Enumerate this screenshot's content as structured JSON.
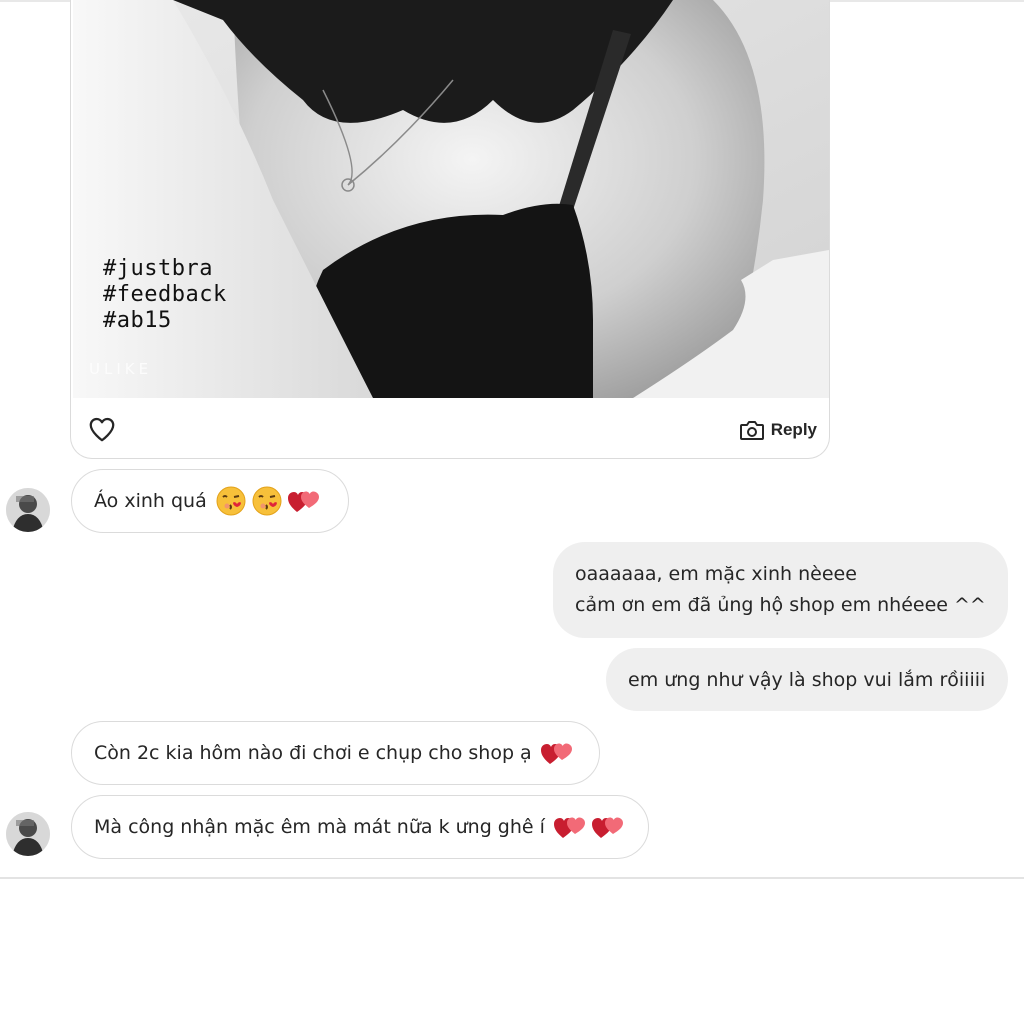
{
  "photo": {
    "hashtags": [
      "#justbra",
      "#feedback",
      "#ab15"
    ],
    "watermark": "ULIKE"
  },
  "card_actions": {
    "reply_label": "Reply",
    "like_icon": "heart-outline-icon",
    "camera_icon": "camera-icon"
  },
  "messages": [
    {
      "side": "incoming",
      "text": "Áo xinh quá",
      "emoji": [
        "kissing-face-icon",
        "kissing-face-icon",
        "two-hearts-icon"
      ]
    },
    {
      "side": "outgoing",
      "lines": [
        "oaaaaaa, em mặc xinh nèeee",
        "cảm ơn em đã ủng hộ shop em nhéeee ^^"
      ]
    },
    {
      "side": "outgoing",
      "text": "em ưng như vậy là shop vui lắm rồiiiii"
    },
    {
      "side": "incoming",
      "text": "Còn 2c kia hôm nào đi chơi e chụp cho shop ạ",
      "emoji": [
        "two-hearts-icon"
      ]
    },
    {
      "side": "incoming",
      "text": "Mà công nhận mặc êm mà mát nữa k ưng ghê í",
      "emoji": [
        "two-hearts-icon",
        "two-hearts-icon"
      ]
    }
  ],
  "colors": {
    "incoming_bubble": "#ffffff",
    "outgoing_bubble": "#efefef",
    "border": "#dbdbdb",
    "text": "#262626",
    "heart_red": "#e0243a"
  }
}
